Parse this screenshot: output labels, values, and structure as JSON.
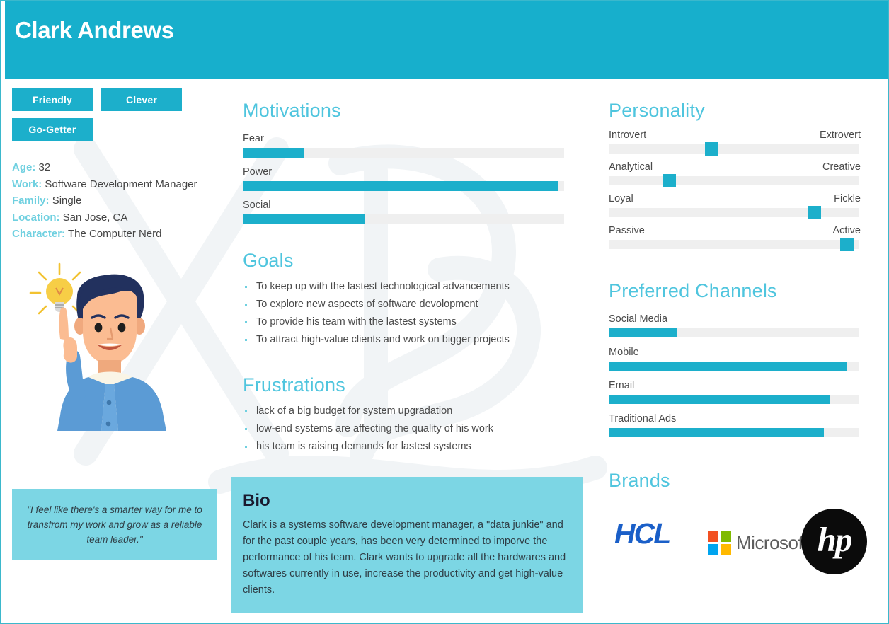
{
  "header": {
    "name": "Clark Andrews"
  },
  "tags": [
    "Friendly",
    "Clever",
    "Go-Getter"
  ],
  "facts": [
    {
      "label": "Age:",
      "value": "32"
    },
    {
      "label": "Work:",
      "value": "Software Development Manager"
    },
    {
      "label": "Family:",
      "value": "Single"
    },
    {
      "label": "Location:",
      "value": "San Jose, CA"
    },
    {
      "label": "Character:",
      "value": "The Computer Nerd"
    }
  ],
  "quote": "\"I feel like there's a smarter way for me to transfrom my work and grow as a reliable team leader.\"",
  "motivations": {
    "title": "Motivations",
    "items": [
      {
        "label": "Fear",
        "value": 19
      },
      {
        "label": "Power",
        "value": 98
      },
      {
        "label": "Social",
        "value": 38
      }
    ]
  },
  "goals": {
    "title": "Goals",
    "items": [
      "To keep up with the lastest technological advancements",
      "To explore new aspects of software devolopment",
      "To provide his team with the lastest systems",
      "To attract high-value clients and work on bigger projects"
    ]
  },
  "frustrations": {
    "title": "Frustrations",
    "items": [
      "lack of a big budget for system upgradation",
      "low-end systems are affecting the quality of his work",
      "his team is raising demands for lastest systems"
    ]
  },
  "bio": {
    "title": "Bio",
    "text": "Clark is a systems software development manager, a \"data junkie\" and for the past couple years, has been very determined to imporve the performance of his team. Clark wants to upgrade all the hardwares and softwares currently in use, increase the productivity and get high-value clients."
  },
  "personality": {
    "title": "Personality",
    "items": [
      {
        "left": "Introvert",
        "right": "Extrovert",
        "value": 41
      },
      {
        "left": "Analytical",
        "right": "Creative",
        "value": 24
      },
      {
        "left": "Loyal",
        "right": "Fickle",
        "value": 82
      },
      {
        "left": "Passive",
        "right": "Active",
        "value": 95
      }
    ]
  },
  "channels": {
    "title": "Preferred Channels",
    "items": [
      {
        "label": "Social Media",
        "value": 27
      },
      {
        "label": "Mobile",
        "value": 95
      },
      {
        "label": "Email",
        "value": 88
      },
      {
        "label": "Traditional Ads",
        "value": 86
      }
    ]
  },
  "brands": {
    "title": "Brands",
    "items": [
      {
        "name": "HCL",
        "label": "HCL"
      },
      {
        "name": "Microsoft",
        "label": "Microsoft"
      },
      {
        "name": "HP",
        "label": "hp"
      }
    ]
  },
  "colors": {
    "header_teal": "#17AFCC",
    "accent": "#1CAFCB",
    "heading": "#4FC5DE",
    "panel": "#7CD6E4",
    "track": "#EFEFEF",
    "msft_red": "#F25022",
    "msft_green": "#7FBA00",
    "msft_blue": "#00A4EF",
    "msft_yellow": "#FFB900"
  },
  "illustration": {
    "name": "man-with-idea-lightbulb"
  },
  "chart_data": [
    {
      "type": "bar",
      "title": "Motivations",
      "categories": [
        "Fear",
        "Power",
        "Social"
      ],
      "values": [
        19,
        98,
        38
      ],
      "xlabel": "",
      "ylabel": "",
      "ylim": [
        0,
        100
      ],
      "orientation": "horizontal",
      "grid": false,
      "legend": "none"
    },
    {
      "type": "bar",
      "title": "Personality",
      "categories": [
        "Introvert-Extrovert",
        "Analytical-Creative",
        "Loyal-Fickle",
        "Passive-Active"
      ],
      "values": [
        41,
        24,
        82,
        95
      ],
      "xlabel": "",
      "ylabel": "",
      "ylim": [
        0,
        100
      ],
      "orientation": "horizontal",
      "grid": false,
      "legend": "none"
    },
    {
      "type": "bar",
      "title": "Preferred Channels",
      "categories": [
        "Social Media",
        "Mobile",
        "Email",
        "Traditional Ads"
      ],
      "values": [
        27,
        95,
        88,
        86
      ],
      "xlabel": "",
      "ylabel": "",
      "ylim": [
        0,
        100
      ],
      "orientation": "horizontal",
      "grid": false,
      "legend": "none"
    }
  ]
}
